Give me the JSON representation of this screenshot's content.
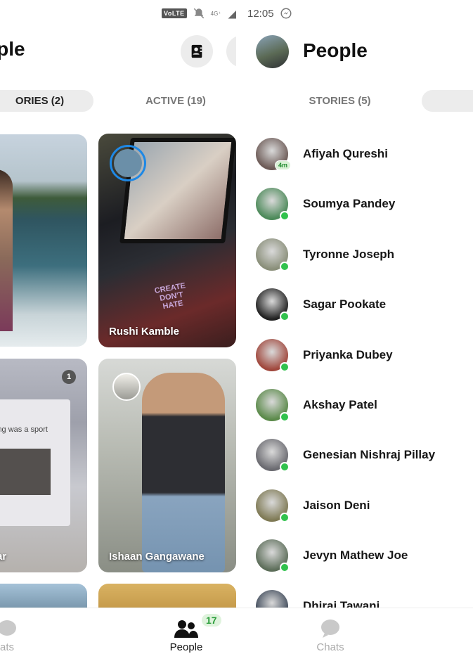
{
  "status_bar": {
    "volte": "VoLTE",
    "network": "4G⁺",
    "clock": "12:05"
  },
  "left_panel": {
    "title": "ople",
    "tabs": [
      {
        "label": "ORIES (2)"
      },
      {
        "label": "ACTIVE (19)"
      }
    ],
    "cards": [
      {
        "name": ""
      },
      {
        "name": "Rushi Kamble",
        "sticker": "CREATE DON'T HATE"
      },
      {
        "name": "ar",
        "unread_count": "1",
        "overlay_text": "ing was a sport"
      },
      {
        "name": "Ishaan Gangawane"
      }
    ]
  },
  "right_panel": {
    "title": "People",
    "tabs": [
      {
        "label": "STORIES (5)"
      },
      {
        "label": ""
      }
    ],
    "people": [
      {
        "name": "Afiyah Qureshi",
        "badge": "4m",
        "online": false,
        "color": "#6d5b57"
      },
      {
        "name": "Soumya Pandey",
        "badge": "",
        "online": true,
        "color": "#4d8a5a"
      },
      {
        "name": "Tyronne Joseph",
        "badge": "",
        "online": true,
        "color": "#8a8f7a"
      },
      {
        "name": "Sagar Pookate",
        "badge": "",
        "online": true,
        "color": "#222222"
      },
      {
        "name": "Priyanka Dubey",
        "badge": "",
        "online": true,
        "color": "#a0473c"
      },
      {
        "name": "Akshay Patel",
        "badge": "",
        "online": true,
        "color": "#5b8a4a"
      },
      {
        "name": "Genesian Nishraj Pillay",
        "badge": "",
        "online": true,
        "color": "#6a6a70"
      },
      {
        "name": "Jaison Deni",
        "badge": "",
        "online": true,
        "color": "#7f7a55"
      },
      {
        "name": "Jevyn Mathew Joe",
        "badge": "",
        "online": true,
        "color": "#5d6e5a"
      },
      {
        "name": "Dhiraj Tawani",
        "badge": "",
        "online": false,
        "color": "#3f4a5a"
      }
    ]
  },
  "bottom_nav": {
    "items": [
      {
        "label": "ats"
      },
      {
        "label": "People",
        "badge": "17"
      },
      {
        "label": "Chats"
      }
    ]
  },
  "colors": {
    "online": "#31c24d",
    "story_ring": "#1e88e5",
    "people_badge": "#2a9d3a"
  }
}
